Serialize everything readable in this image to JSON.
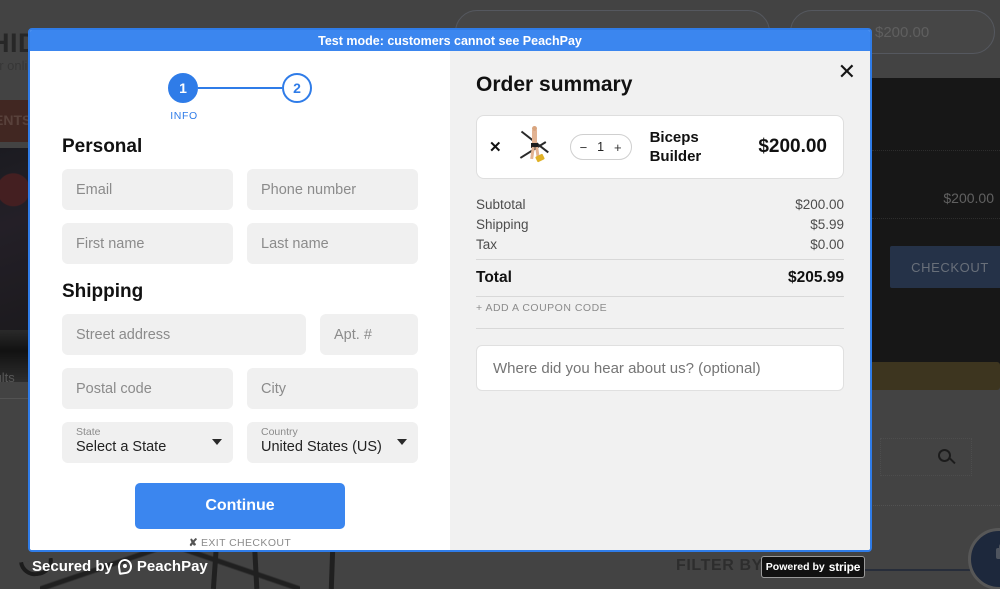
{
  "background": {
    "brand": "HID",
    "brand_sub": "ur onli",
    "menu_label": "ENTS",
    "results_text": "sults",
    "sorting_text": "g",
    "cart_price": "$200.00",
    "checkout_label": "CHECKOUT",
    "pill_value": "$200.00",
    "filter_by_price": "FILTER BY PRICE",
    "stripe_badge": {
      "powered_by": "Powered by",
      "brand": "stripe"
    }
  },
  "modal": {
    "test_banner": "Test mode: customers cannot see PeachPay",
    "close_icon": "close-icon",
    "stepper": {
      "step1": "1",
      "step2": "2",
      "active_label": "INFO"
    },
    "personal": {
      "heading": "Personal",
      "email_placeholder": "Email",
      "phone_placeholder": "Phone number",
      "first_name_placeholder": "First name",
      "last_name_placeholder": "Last name"
    },
    "shipping": {
      "heading": "Shipping",
      "street_placeholder": "Street address",
      "apt_placeholder": "Apt. #",
      "postal_placeholder": "Postal code",
      "city_placeholder": "City",
      "state_label": "State",
      "state_value": "Select a State",
      "country_label": "Country",
      "country_value": "United States (US)"
    },
    "continue_label": "Continue",
    "exit_label": "EXIT CHECKOUT",
    "exit_mark": "✘"
  },
  "order_summary": {
    "title": "Order summary",
    "item": {
      "remove_label": "✕",
      "thumb_icon": "product-thumbnail",
      "qty_minus": "−",
      "qty_value": "1",
      "qty_plus": "+",
      "name_line1": "Biceps",
      "name_line2": "Builder",
      "price": "$200.00"
    },
    "lines": [
      {
        "label": "Subtotal",
        "value": "$200.00"
      },
      {
        "label": "Shipping",
        "value": "$5.99"
      },
      {
        "label": "Tax",
        "value": "$0.00"
      }
    ],
    "total": {
      "label": "Total",
      "value": "$205.99"
    },
    "coupon_label": "+ ADD A COUPON CODE",
    "hear_placeholder": "Where did you hear about us? (optional)"
  },
  "footer": {
    "secured_prefix": "Secured by",
    "secured_brand": "PeachPay"
  },
  "colors": {
    "accent": "#3b86ef",
    "modal_border": "#2f7ce8",
    "field_bg": "#f0f0f0",
    "summary_bg": "#f1f1f1"
  }
}
